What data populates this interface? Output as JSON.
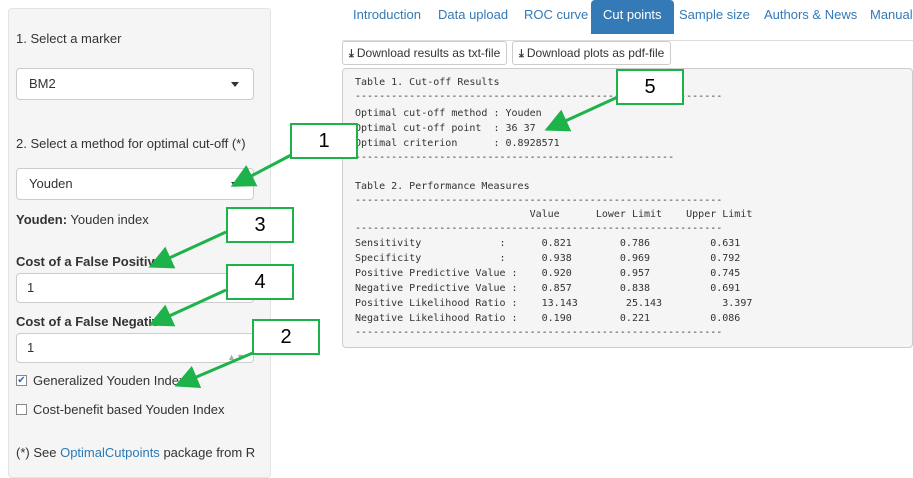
{
  "sidebar": {
    "marker_label": "1. Select a marker",
    "marker_value": "BM2",
    "method_label": "2. Select a method for optimal cut-off (*)",
    "method_value": "Youden",
    "method_desc_name": "Youden:",
    "method_desc_text": "Youden index",
    "cost_fp_label": "Cost of a False Positive",
    "cost_fp_value": "1",
    "cost_fn_label": "Cost of a False Negative",
    "cost_fn_value": "1",
    "gen_youden_label": "Generalized Youden Index",
    "gen_youden_checked": true,
    "cost_benefit_label": "Cost-benefit based Youden Index",
    "cost_benefit_checked": false,
    "footnote_prefix": "(*) See",
    "footnote_link": "OptimalCutpoints",
    "footnote_suffix": "package from R"
  },
  "tabs": [
    {
      "label": "Introduction"
    },
    {
      "label": "Data upload"
    },
    {
      "label": "ROC curve"
    },
    {
      "label": "Cut points",
      "active": true
    },
    {
      "label": "Sample size"
    },
    {
      "label": "Authors & News"
    },
    {
      "label": "Manual"
    }
  ],
  "buttons": {
    "download_txt": "Download results as txt-file",
    "download_pdf": "Download plots as pdf-file"
  },
  "output": {
    "table1_title": "Table 1. Cut-off Results",
    "separator": "-------------------------------------------------------------",
    "method_line": "Optimal cut-off method : Youden",
    "point_line": "Optimal cut-off point  : 36 37",
    "criterion_line": "Optimal criterion      : 0.8928571",
    "sep_short": "-----------------------------------------------------",
    "table2_title": "Table 2. Performance Measures",
    "header": "                             Value      Lower Limit    Upper Limit",
    "rows": [
      "Sensitivity             :      0.821        0.786          0.631",
      "Specificity             :      0.938        0.969          0.792",
      "Positive Predictive Value :    0.920        0.957          0.745",
      "Negative Predictive Value :    0.857        0.838          0.691",
      "Positive Likelihood Ratio :    13.143        25.143          3.397",
      "Negative Likelihood Ratio :    0.190        0.221          0.086"
    ]
  },
  "callouts": [
    "1",
    "2",
    "3",
    "4",
    "5"
  ],
  "colors": {
    "accent": "#337ab7",
    "callout_border": "#1db24a"
  }
}
